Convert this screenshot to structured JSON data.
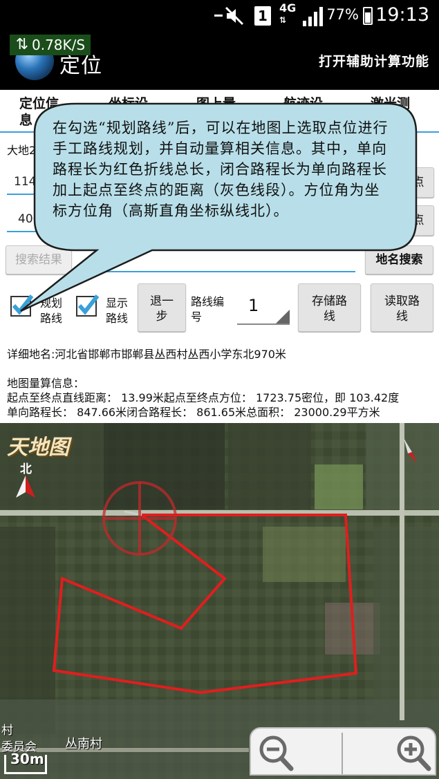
{
  "status_bar": {
    "network_type": "4G",
    "sim_slot": "1",
    "battery": "77%",
    "time": "19:13"
  },
  "app_bar": {
    "speed": "0.78K/S",
    "title": "定位",
    "assist_action": "打开辅助计算功能"
  },
  "tabs": [
    {
      "line1": "定位信",
      "line2": "息"
    },
    {
      "line1": "坐标设",
      "line2": ""
    },
    {
      "line1": "图上量",
      "line2": ""
    },
    {
      "line1": "航迹设",
      "line2": ""
    },
    {
      "line1": "激光测",
      "line2": ""
    }
  ],
  "form": {
    "datum_label": "大地2",
    "lon_value": "114",
    "lat_value": "406",
    "point_button_1": "点",
    "point_button_2": "点",
    "search_results_button": "搜索结果",
    "place_search_button": "地名搜索"
  },
  "controls": {
    "plan_route_label_line1": "规划",
    "plan_route_label_line2": "路线",
    "show_route_label_line1": "显示",
    "show_route_label_line2": "路线",
    "undo_label_line1": "退一",
    "undo_label_line2": "步",
    "route_number_label_line1": "路线编",
    "route_number_label_line2": "号",
    "route_number_value": "1",
    "save_route_line1": "存储路",
    "save_route_line2": "线",
    "load_route_line1": "读取路",
    "load_route_line2": "线"
  },
  "info": {
    "address": "详细地名:河北省邯郸市邯郸县丛西村丛西小学东北970米",
    "measure_header": "地图量算信息：",
    "distance_line": "起点至终点直线距离： 13.99米起点至终点方位： 1723.75密位，即 103.42度",
    "length_line": "单向路程长： 847.66米闭合路程长： 861.65米总面积： 23000.29平方米"
  },
  "map": {
    "provider_logo": "天地图",
    "north_label": "北",
    "place_label_1": "村",
    "place_label_2": "委员会",
    "place_label_3": "丛南村",
    "scale_label": "30m",
    "route_color": "#e01e1e"
  },
  "callout": {
    "text": "在勾选“规划路线”后，可以在地图上选取点位进行手工路线规划，并自动量算相关信息。其中，单向路程长为红色折线总长，闭合路程长为单向路程长加上起点至终点的距离（灰色线段）。方位角为坐标方位角（高斯直角坐标纵线北）。"
  }
}
